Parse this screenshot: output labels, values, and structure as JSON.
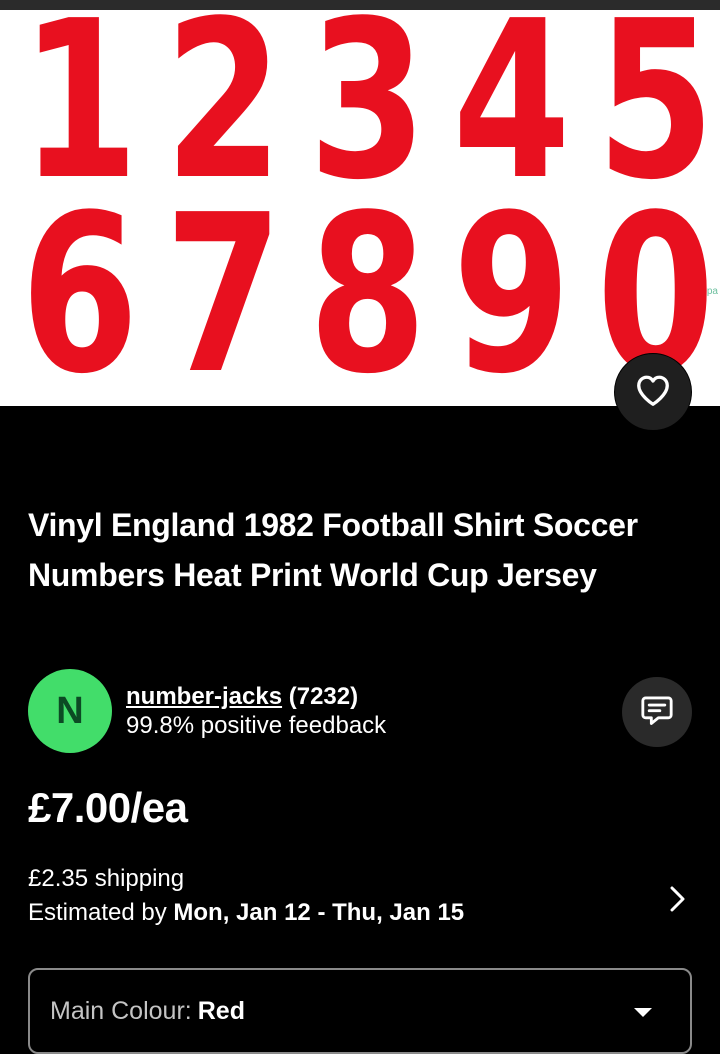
{
  "product_image": {
    "row1": [
      "1",
      "2",
      "3",
      "4",
      "5"
    ],
    "row2": [
      "6",
      "7",
      "8",
      "9",
      "0"
    ],
    "digit_color": "#e8101f",
    "watermark": "pa"
  },
  "favorite": {
    "icon": "heart-icon"
  },
  "title": "Vinyl England 1982 Football Shirt Soccer Numbers Heat Print World Cup Jersey",
  "seller": {
    "avatar_letter": "N",
    "avatar_color": "#42dd6a",
    "username": "number-jacks",
    "rating_count": "(7232)",
    "feedback": "99.8% positive feedback",
    "chat_icon": "chat-bubble-icon"
  },
  "price": "£7.00/ea",
  "shipping": {
    "cost": "£2.35 shipping",
    "estimate_prefix": "Estimated by",
    "estimate_dates": "Mon, Jan 12 - Thu, Jan 15",
    "icon": "chevron-right-icon"
  },
  "variant_select": {
    "label": "Main Colour:",
    "value": "Red",
    "icon": "chevron-down-icon"
  }
}
